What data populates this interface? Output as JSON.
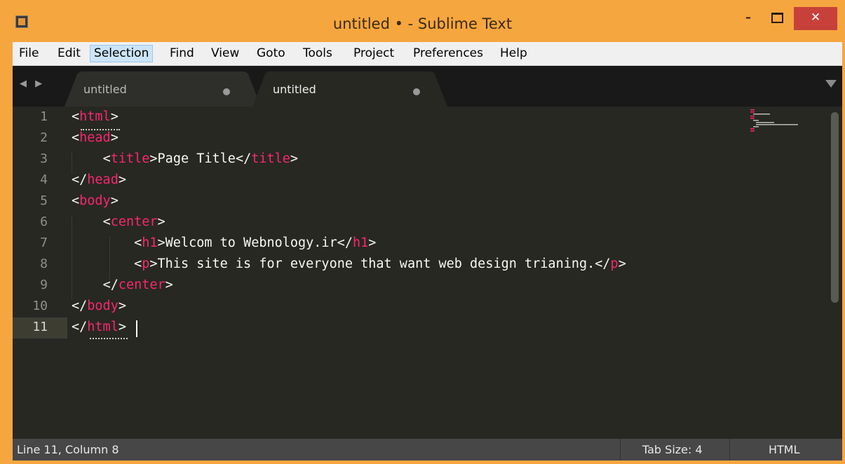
{
  "window": {
    "title": "untitled • - Sublime Text",
    "minimize_label": "–",
    "close_label": "✕"
  },
  "menu": [
    "File",
    "Edit",
    "Selection",
    "Find",
    "View",
    "Goto",
    "Tools",
    "Project",
    "Preferences",
    "Help"
  ],
  "menu_active": "Selection",
  "tabs": [
    {
      "label": "untitled",
      "active": false,
      "dirty": true
    },
    {
      "label": "untitled",
      "active": true,
      "dirty": true
    }
  ],
  "editor": {
    "line_numbers": [
      "1",
      "2",
      "3",
      "4",
      "5",
      "6",
      "7",
      "8",
      "9",
      "10",
      "11"
    ],
    "current_line": 11,
    "lines": [
      "<html>",
      "<head>",
      "    <title>Page Title</title>",
      "</head>",
      "<body>",
      "    <center>",
      "        <h1>Welcom to Webnology.ir</h1>",
      "        <p>This site is for everyone that want web design trianing.</p>",
      "    </center>",
      "</body>",
      "</html>"
    ]
  },
  "status": {
    "position": "Line 11, Column 8",
    "tab_size": "Tab Size: 4",
    "syntax": "HTML"
  },
  "colors": {
    "titlebar": "#f6a63e",
    "editor_bg": "#272822",
    "tag": "#f92672",
    "text": "#f8f8f2",
    "close": "#c7413a"
  }
}
